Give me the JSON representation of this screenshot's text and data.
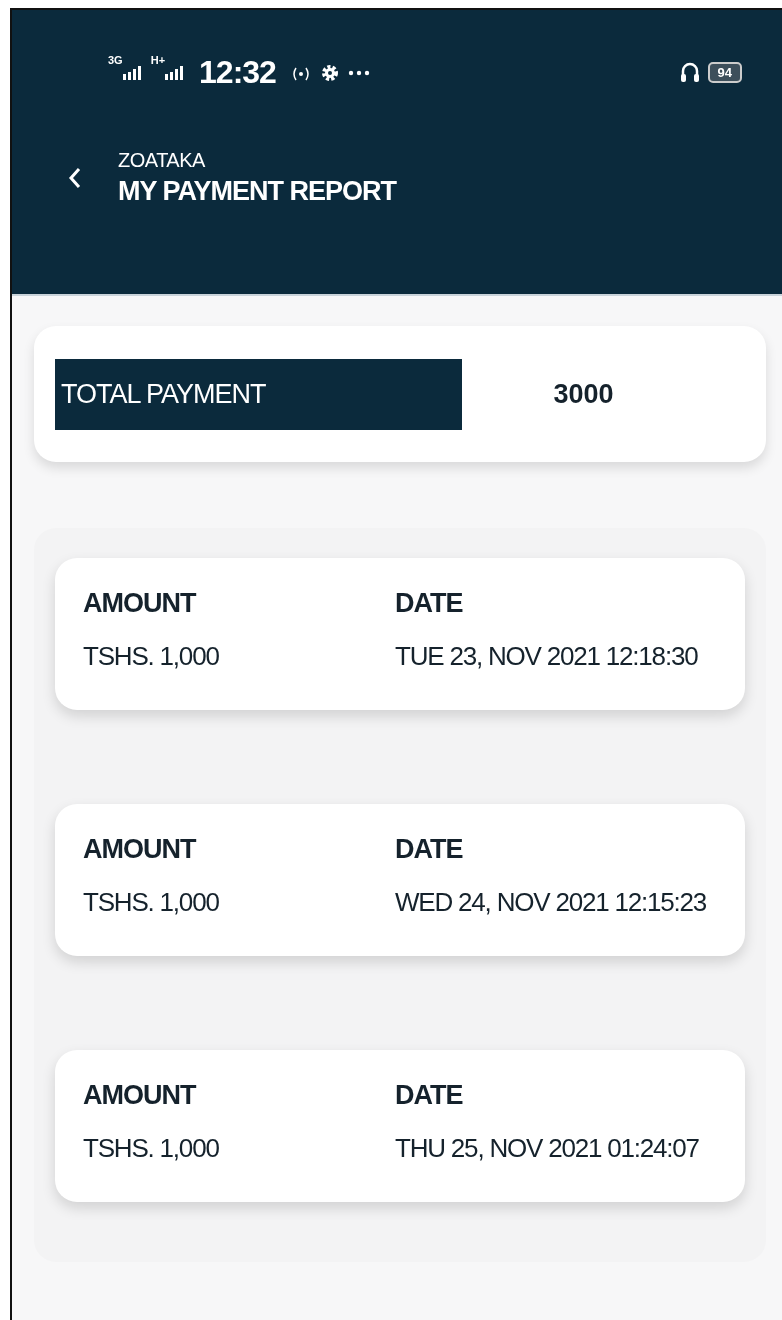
{
  "status_bar": {
    "network_1": "3G",
    "network_2": "H+",
    "time": "12:32",
    "battery": "94"
  },
  "header": {
    "subtitle": "ZOATAKA",
    "title": "MY PAYMENT REPORT"
  },
  "summary": {
    "label": "TOTAL PAYMENT",
    "value": "3000"
  },
  "payments": [
    {
      "amount_label": "AMOUNT",
      "amount": "TSHS. 1,000",
      "date_label": "DATE",
      "date": "TUE 23, NOV 2021 12:18:30"
    },
    {
      "amount_label": "AMOUNT",
      "amount": "TSHS. 1,000",
      "date_label": "DATE",
      "date": "WED 24, NOV 2021 12:15:23"
    },
    {
      "amount_label": "AMOUNT",
      "amount": "TSHS. 1,000",
      "date_label": "DATE",
      "date": "THU 25, NOV 2021 01:24:07"
    }
  ]
}
